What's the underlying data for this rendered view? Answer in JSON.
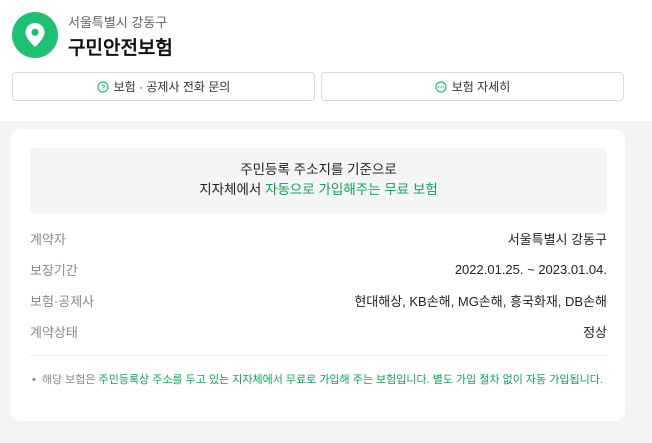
{
  "header": {
    "region": "서울특별시 강동구",
    "title": "구민안전보험",
    "brand_color": "#1ec074"
  },
  "buttons": {
    "call": {
      "label": "보험 · 공제사 전화 문의",
      "icon": "question-circle-icon"
    },
    "detail": {
      "label": "보험 자세히",
      "icon": "more-circle-icon"
    }
  },
  "notice": {
    "line1": "주민등록 주소지를 기준으로",
    "line2_prefix": "지자체에서 ",
    "line2_highlight": "자동으로 가입해주는 무료 보험",
    "highlight_color": "#14a05a"
  },
  "details": [
    {
      "key": "계약자",
      "value": "서울특별시 강동구"
    },
    {
      "key": "보장기간",
      "value": "2022.01.25. ~ 2023.01.04."
    },
    {
      "key": "보험·공제사",
      "value": "현대해상, KB손해, MG손해, 흥국화재, DB손해"
    },
    {
      "key": "계약상태",
      "value": "정상"
    }
  ],
  "footnote": {
    "bullet": "•",
    "prefix": "해당 보험은 ",
    "highlight": "주민등록상 주소를 두고 있는 지자체에서 무료로 가입해 주는 보험입니다. 별도 가입 절차 없이 자동 가입됩니다."
  }
}
